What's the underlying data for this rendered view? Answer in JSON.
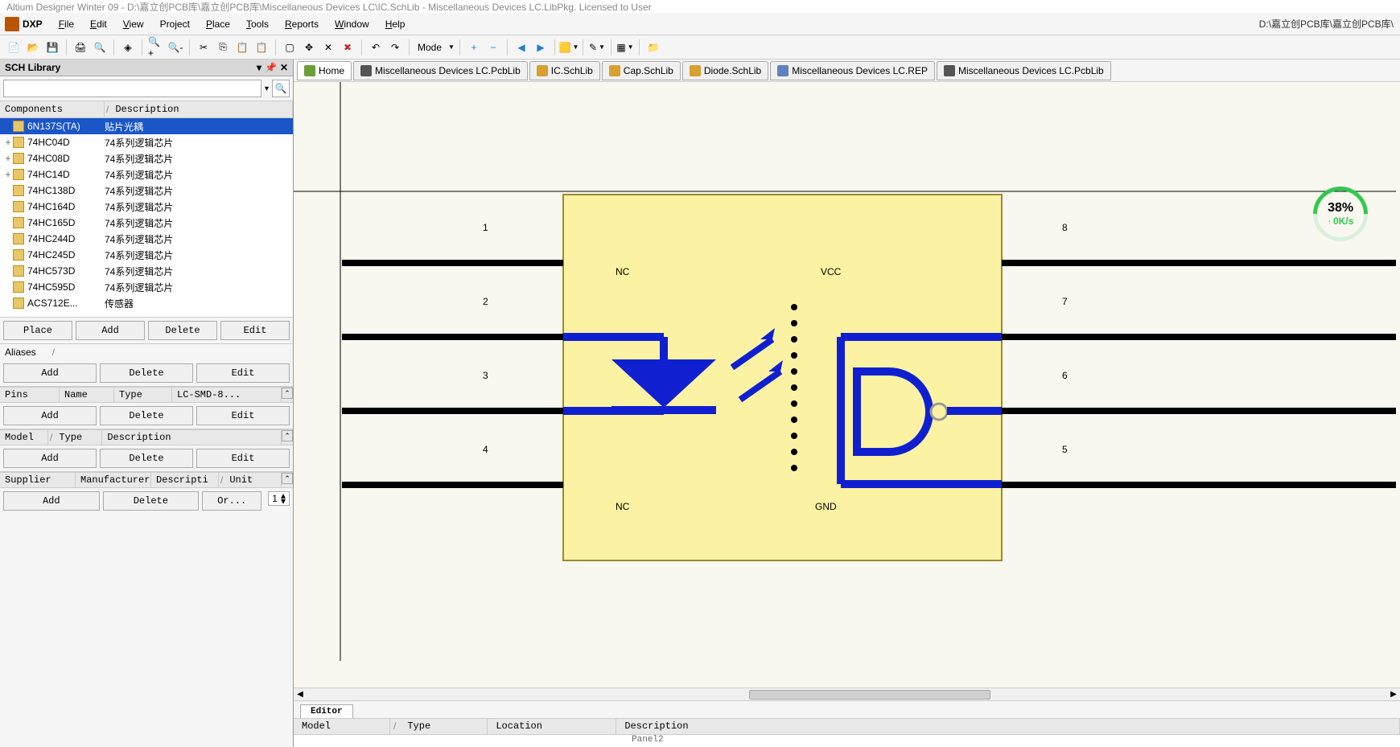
{
  "title_fragment": "Altium Designer Winter 09 - D:\\嘉立创PCB库\\嘉立创PCB库\\Miscellaneous Devices LC\\IC.SchLib - Miscellaneous Devices LC.LibPkg. Licensed to User",
  "right_path": "D:\\嘉立创PCB库\\嘉立创PCB库\\",
  "menus": {
    "dxp": "DXP",
    "file": "File",
    "edit": "Edit",
    "view": "View",
    "project": "Project",
    "place": "Place",
    "tools": "Tools",
    "reports": "Reports",
    "window": "Window",
    "help": "Help"
  },
  "toolbar": {
    "mode_label": "Mode"
  },
  "panel": {
    "title": "SCH Library",
    "search_placeholder": "",
    "grid": {
      "components": "Components",
      "description": "Description"
    },
    "buttons": {
      "place": "Place",
      "add": "Add",
      "delete": "Delete",
      "edit": "Edit",
      "order": "Or..."
    },
    "aliases": "Aliases",
    "pins_header": {
      "pins": "Pins",
      "name": "Name",
      "type": "Type",
      "extra": "LC-SMD-8..."
    },
    "model_header": {
      "model": "Model",
      "type": "Type",
      "description": "Description"
    },
    "supplier_header": {
      "supplier": "Supplier",
      "manufacturer": "Manufacturer",
      "descripti": "Descripti",
      "unit": "Unit"
    },
    "spinner_value": "1",
    "components": [
      {
        "tree": "",
        "name": "6N137S(TA)",
        "desc": "贴片光耦",
        "selected": true
      },
      {
        "tree": "+",
        "name": "74HC04D",
        "desc": "74系列逻辑芯片"
      },
      {
        "tree": "+",
        "name": "74HC08D",
        "desc": "74系列逻辑芯片"
      },
      {
        "tree": "+",
        "name": "74HC14D",
        "desc": "74系列逻辑芯片"
      },
      {
        "tree": "",
        "name": "74HC138D",
        "desc": "74系列逻辑芯片"
      },
      {
        "tree": "",
        "name": "74HC164D",
        "desc": "74系列逻辑芯片"
      },
      {
        "tree": "",
        "name": "74HC165D",
        "desc": "74系列逻辑芯片"
      },
      {
        "tree": "",
        "name": "74HC244D",
        "desc": "74系列逻辑芯片"
      },
      {
        "tree": "",
        "name": "74HC245D",
        "desc": "74系列逻辑芯片"
      },
      {
        "tree": "",
        "name": "74HC573D",
        "desc": "74系列逻辑芯片"
      },
      {
        "tree": "",
        "name": "74HC595D",
        "desc": "74系列逻辑芯片"
      },
      {
        "tree": "",
        "name": "ACS712E...",
        "desc": "传感器"
      }
    ]
  },
  "tabs": [
    {
      "label": "Home",
      "icon": "home-i"
    },
    {
      "label": "Miscellaneous Devices LC.PcbLib",
      "icon": "pcb-i"
    },
    {
      "label": "IC.SchLib",
      "icon": "sch-i"
    },
    {
      "label": "Cap.SchLib",
      "icon": "sch-i"
    },
    {
      "label": "Diode.SchLib",
      "icon": "sch-i"
    },
    {
      "label": "Miscellaneous Devices LC.REP",
      "icon": "rep-i"
    },
    {
      "label": "Miscellaneous Devices LC.PcbLib",
      "icon": "pcb-i"
    }
  ],
  "schematic": {
    "pins_left": [
      "1",
      "2",
      "3",
      "4"
    ],
    "pins_right": [
      "8",
      "7",
      "6",
      "5"
    ],
    "labels": {
      "nc_top": "NC",
      "vcc": "VCC",
      "nc_bot": "NC",
      "gnd": "GND"
    }
  },
  "float": {
    "percent": "38%",
    "rate": "0K/s"
  },
  "editor_tab": "Editor",
  "bottom_cols": {
    "model": "Model",
    "type": "Type",
    "location": "Location",
    "description": "Description"
  },
  "bottom_text": "Panel2"
}
